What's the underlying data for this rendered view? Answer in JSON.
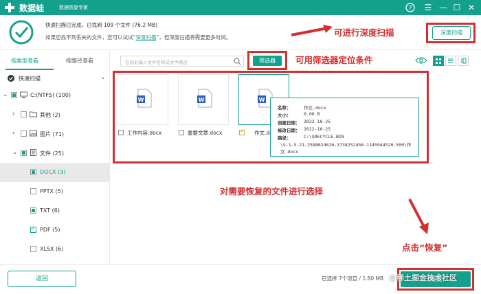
{
  "colors": {
    "brand": "#13a08d",
    "annotation": "#d32f2f"
  },
  "titlebar": {
    "app_name": "数据蛙",
    "tagline": "数据恢复专家",
    "icons": [
      "help-icon",
      "menu-icon",
      "minimize-icon",
      "maximize-icon",
      "close-icon"
    ]
  },
  "status": {
    "line1": "快速扫描已完成，已找到 109 个文件 (76.2 MB)",
    "line2_prefix": "如果您找不到丢失的文件，您可以试试“",
    "line2_link": "深度扫描",
    "line2_suffix": "”，但深度扫描将需要更多时间。",
    "deep_scan_button": "深度扫描"
  },
  "left_panel": {
    "tabs": [
      "按类型查看",
      "按路径查看"
    ],
    "tree": {
      "quick_scan": "快速扫描",
      "drive": "C:(NTFS) (100)",
      "other": "其他 (2)",
      "pictures": "图片 (71)",
      "documents": "文件 (25)",
      "docx": "DOCX (3)",
      "pptx": "PPTX (5)",
      "txt": "TXT (6)",
      "pdf": "PDF (5)",
      "xlsx": "XLSX (6)"
    }
  },
  "toolbar": {
    "search_placeholder": "在此处输入文件名称或文件路径",
    "filter_button": "筛选器"
  },
  "annotations": {
    "deep_scan": "可进行深度扫描",
    "filter": "可用筛选器定位条件",
    "select": "对需要恢复的文件进行选择",
    "restore": "点击“恢复”"
  },
  "files": [
    {
      "name": "工作内容.docx",
      "checked": false
    },
    {
      "name": "重要文章.docx",
      "checked": false
    },
    {
      "name": "作文.do",
      "checked": true
    }
  ],
  "tooltip": {
    "name_key": "名称：",
    "name_val": "作文.docx",
    "size_key": "大小：",
    "size_val": "0.00 B",
    "created_key": "创建日期：",
    "created_val": "2022-10-25",
    "modified_key": "修改日期：",
    "modified_val": "2022-10-25",
    "path_key": "路径：",
    "path_val1": "C:\\$RECYCLE.BIN",
    "path_val2": "\\S-1-5-21-2588024626-3738252456-1145944520-500\\作",
    "path_val3": "文.docx"
  },
  "footer": {
    "back_button": "返回",
    "summary": "已选择 7个项目 / 1.80 MB",
    "restore_button": "恢复",
    "watermark": "@稀土掘金技术社区"
  }
}
